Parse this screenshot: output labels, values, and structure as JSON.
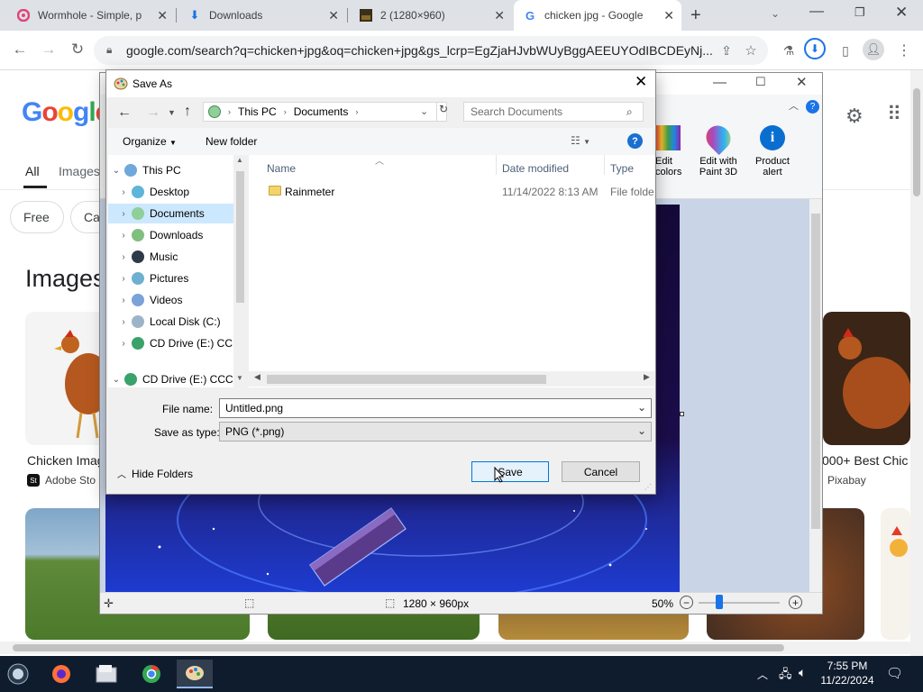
{
  "browser": {
    "tabs": [
      {
        "title": "Wormhole - Simple, p",
        "icon": "wormhole-icon"
      },
      {
        "title": "Downloads",
        "icon": "download-icon"
      },
      {
        "title": "2 (1280×960)",
        "icon": "image-icon"
      },
      {
        "title": "chicken jpg - Google",
        "icon": "google-icon"
      }
    ],
    "url": "google.com/search?q=chicken+jpg&oq=chicken+jpg&gs_lcrp=EgZjaHJvbWUyBggAEEUYOdIBCDEyNj..."
  },
  "google": {
    "logo": "Google",
    "nav_all": "All",
    "nav_images": "Images",
    "chips": [
      "Free",
      "Ca"
    ],
    "section_heading": "Images",
    "results": [
      {
        "title": "Chicken Imag",
        "source": "Adobe Sto"
      },
      {
        "title": "000+ Best Chic",
        "source": "Pixabay"
      }
    ]
  },
  "paint": {
    "ribbon": {
      "edit_colors": "Edit colors",
      "edit_with_paint3d": "Edit with Paint 3D",
      "product_alert": "Product alert"
    },
    "status": {
      "dimensions": "1280 × 960px",
      "zoom": "50%"
    }
  },
  "dialog": {
    "title": "Save As",
    "breadcrumb": [
      "This PC",
      "Documents"
    ],
    "search_placeholder": "Search Documents",
    "organize": "Organize",
    "new_folder": "New folder",
    "tree": [
      {
        "label": "This PC",
        "indent": 0,
        "expanded": true
      },
      {
        "label": "Desktop",
        "indent": 1
      },
      {
        "label": "Documents",
        "indent": 1,
        "selected": true
      },
      {
        "label": "Downloads",
        "indent": 1
      },
      {
        "label": "Music",
        "indent": 1
      },
      {
        "label": "Pictures",
        "indent": 1
      },
      {
        "label": "Videos",
        "indent": 1
      },
      {
        "label": "Local Disk (C:)",
        "indent": 1
      },
      {
        "label": "CD Drive (E:) CC",
        "indent": 1
      },
      {
        "label": "CD Drive (E:) CCC",
        "indent": 0,
        "expanded": true
      }
    ],
    "columns": {
      "name": "Name",
      "date": "Date modified",
      "type": "Type"
    },
    "files": [
      {
        "name": "Rainmeter",
        "date": "11/14/2022 8:13 AM",
        "type": "File folder"
      }
    ],
    "file_name_label": "File name:",
    "file_name_value": "Untitled.png",
    "save_as_type_label": "Save as type:",
    "save_as_type_value": "PNG (*.png)",
    "hide_folders": "Hide Folders",
    "save": "Save",
    "cancel": "Cancel"
  },
  "taskbar": {
    "time": "7:55 PM",
    "date": "11/22/2024"
  }
}
